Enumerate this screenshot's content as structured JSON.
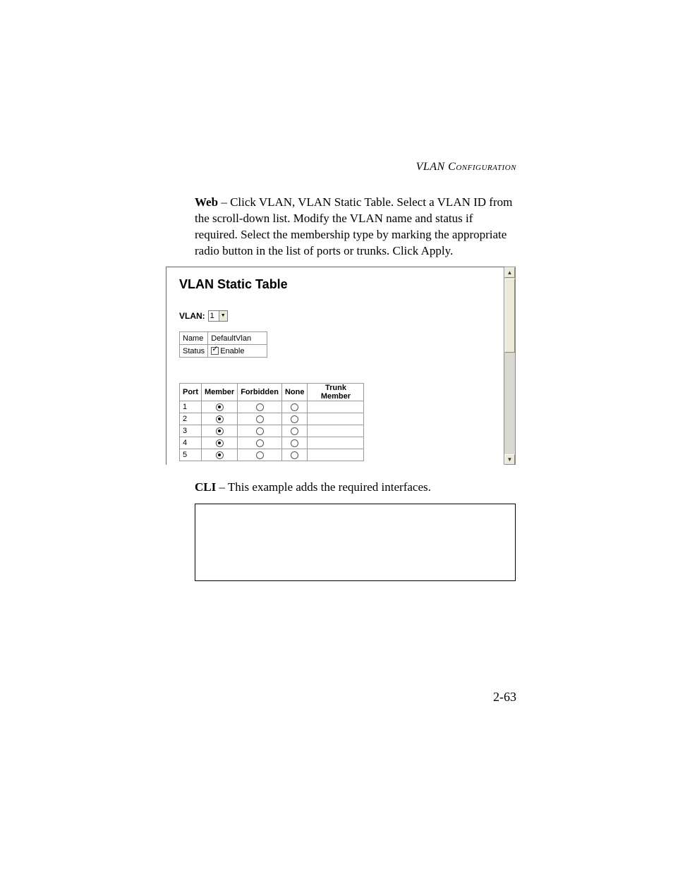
{
  "header": {
    "section_title": "VLAN Configuration"
  },
  "web": {
    "label_bold": "Web",
    "instructions": " – Click VLAN, VLAN Static Table. Select a VLAN ID from the scroll-down list. Modify the VLAN name and status if required. Select the membership type by marking the appropriate radio button in the list of ports or trunks. Click Apply."
  },
  "screenshot": {
    "title": "VLAN Static Table",
    "vlan_label": "VLAN:",
    "vlan_value": "1",
    "name_label": "Name",
    "name_value": "DefaultVlan",
    "status_label": "Status",
    "status_checkbox_label": "Enable",
    "status_checked": true,
    "port_headers": {
      "port": "Port",
      "member": "Member",
      "forbidden": "Forbidden",
      "none": "None",
      "trunk_member": "Trunk Member"
    },
    "ports": [
      {
        "port": "1",
        "sel": "member",
        "trunk_member": ""
      },
      {
        "port": "2",
        "sel": "member",
        "trunk_member": ""
      },
      {
        "port": "3",
        "sel": "member",
        "trunk_member": ""
      },
      {
        "port": "4",
        "sel": "member",
        "trunk_member": ""
      },
      {
        "port": "5",
        "sel": "member",
        "trunk_member": ""
      }
    ]
  },
  "cli": {
    "label_bold": "CLI",
    "text": " – This example adds the required interfaces."
  },
  "page_number": "2-63"
}
